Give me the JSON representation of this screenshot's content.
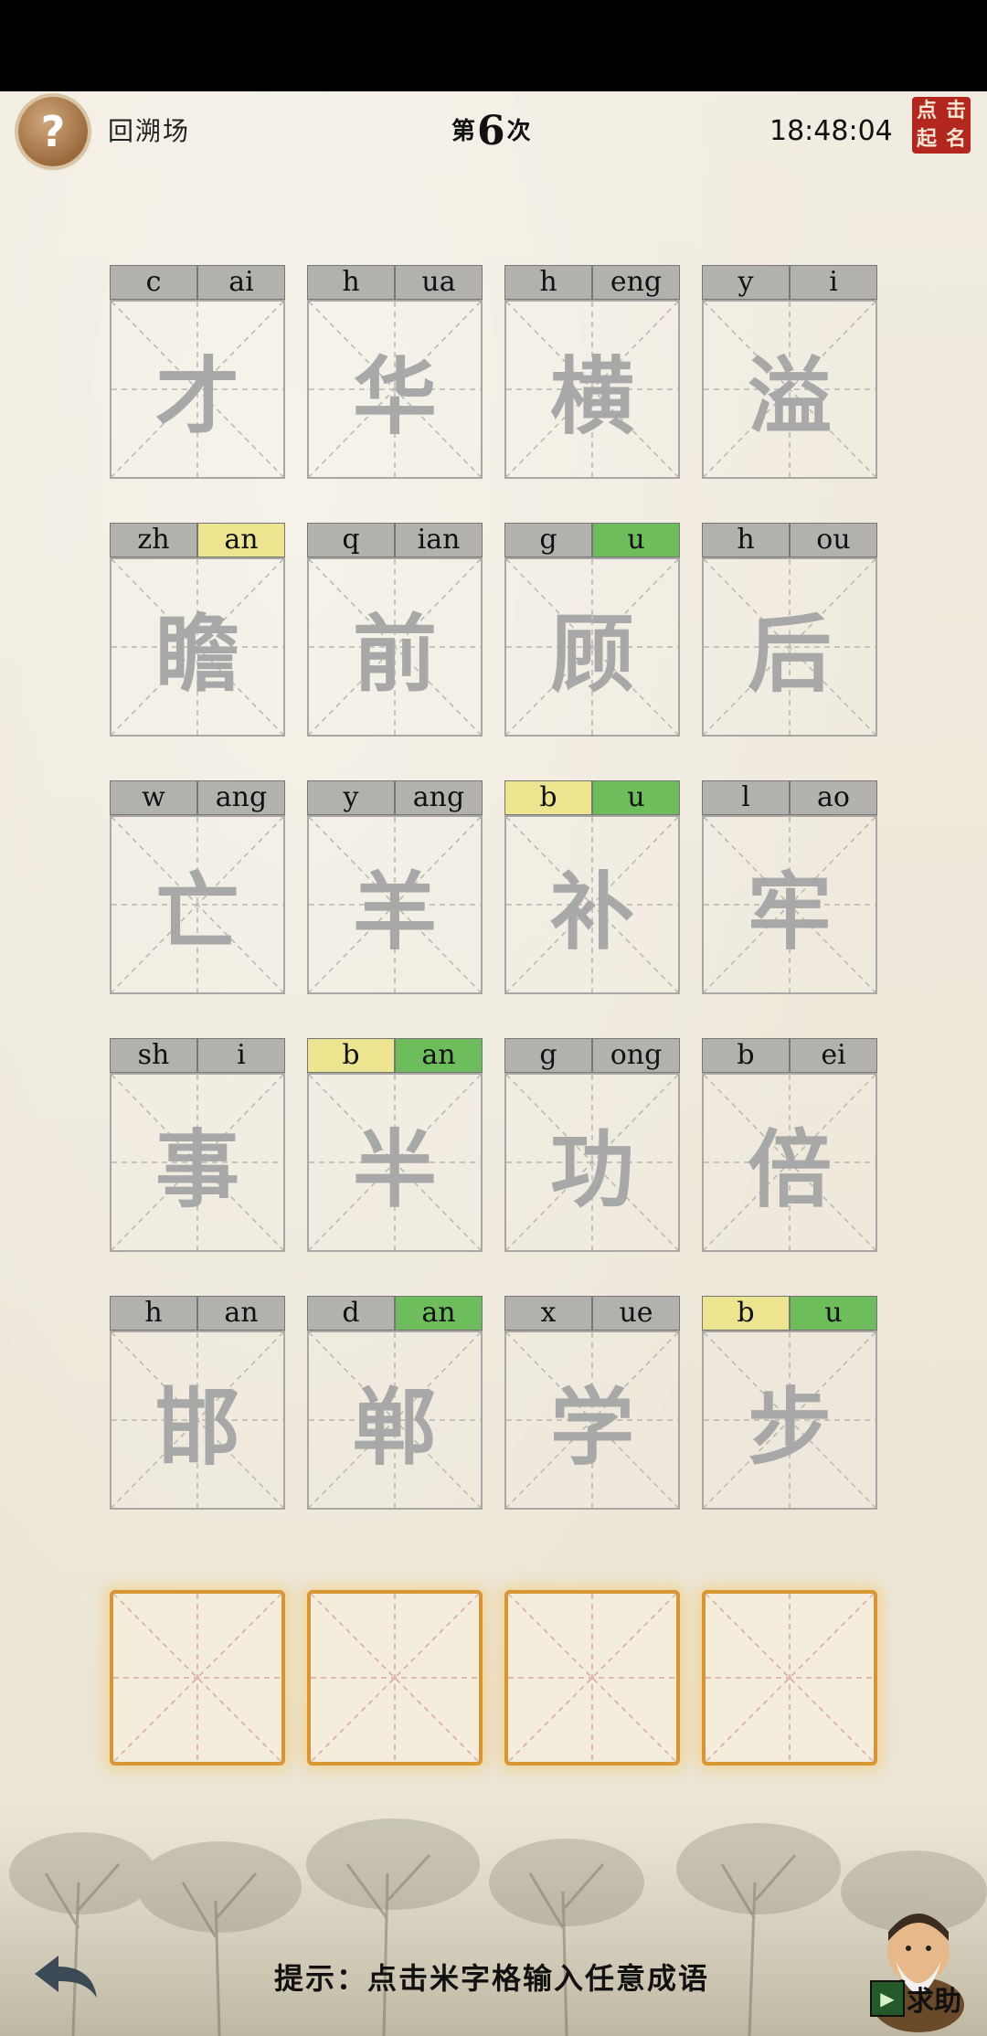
{
  "header": {
    "help_icon": "question-mark-icon",
    "help_label": "?",
    "level_name": "回溯场",
    "round_prefix": "第",
    "round_number": "6",
    "round_suffix": "次",
    "clock": "18:48:04",
    "seal_chars": [
      "点",
      "击",
      "起",
      "名"
    ]
  },
  "cells": [
    {
      "char": "才",
      "initial": "c",
      "final": "ai",
      "initial_state": "none",
      "final_state": "none"
    },
    {
      "char": "华",
      "initial": "h",
      "final": "ua",
      "initial_state": "none",
      "final_state": "none"
    },
    {
      "char": "横",
      "initial": "h",
      "final": "eng",
      "initial_state": "none",
      "final_state": "none"
    },
    {
      "char": "溢",
      "initial": "y",
      "final": "i",
      "initial_state": "none",
      "final_state": "none"
    },
    {
      "char": "瞻",
      "initial": "zh",
      "final": "an",
      "initial_state": "none",
      "final_state": "yellow"
    },
    {
      "char": "前",
      "initial": "q",
      "final": "ian",
      "initial_state": "none",
      "final_state": "none"
    },
    {
      "char": "顾",
      "initial": "g",
      "final": "u",
      "initial_state": "none",
      "final_state": "green"
    },
    {
      "char": "后",
      "initial": "h",
      "final": "ou",
      "initial_state": "none",
      "final_state": "none"
    },
    {
      "char": "亡",
      "initial": "w",
      "final": "ang",
      "initial_state": "none",
      "final_state": "none"
    },
    {
      "char": "羊",
      "initial": "y",
      "final": "ang",
      "initial_state": "none",
      "final_state": "none"
    },
    {
      "char": "补",
      "initial": "b",
      "final": "u",
      "initial_state": "yellow",
      "final_state": "green"
    },
    {
      "char": "牢",
      "initial": "l",
      "final": "ao",
      "initial_state": "none",
      "final_state": "none"
    },
    {
      "char": "事",
      "initial": "sh",
      "final": "i",
      "initial_state": "none",
      "final_state": "none"
    },
    {
      "char": "半",
      "initial": "b",
      "final": "an",
      "initial_state": "yellow",
      "final_state": "green"
    },
    {
      "char": "功",
      "initial": "g",
      "final": "ong",
      "initial_state": "none",
      "final_state": "none"
    },
    {
      "char": "倍",
      "initial": "b",
      "final": "ei",
      "initial_state": "none",
      "final_state": "none"
    },
    {
      "char": "邯",
      "initial": "h",
      "final": "an",
      "initial_state": "none",
      "final_state": "none"
    },
    {
      "char": "郸",
      "initial": "d",
      "final": "an",
      "initial_state": "none",
      "final_state": "green"
    },
    {
      "char": "学",
      "initial": "x",
      "final": "ue",
      "initial_state": "none",
      "final_state": "none"
    },
    {
      "char": "步",
      "initial": "b",
      "final": "u",
      "initial_state": "yellow",
      "final_state": "green"
    }
  ],
  "answer_slots": 4,
  "footer": {
    "back_icon": "back-arrow-icon",
    "hint": "提示：点击米字格输入任意成语",
    "helper_icon": "film-icon",
    "helper_label": "求助"
  },
  "colors": {
    "yellow": "#ece48e",
    "green": "#6dbd5c",
    "gray": "#b3b1ae",
    "answer_border": "#d89532",
    "seal": "#b3271f"
  }
}
